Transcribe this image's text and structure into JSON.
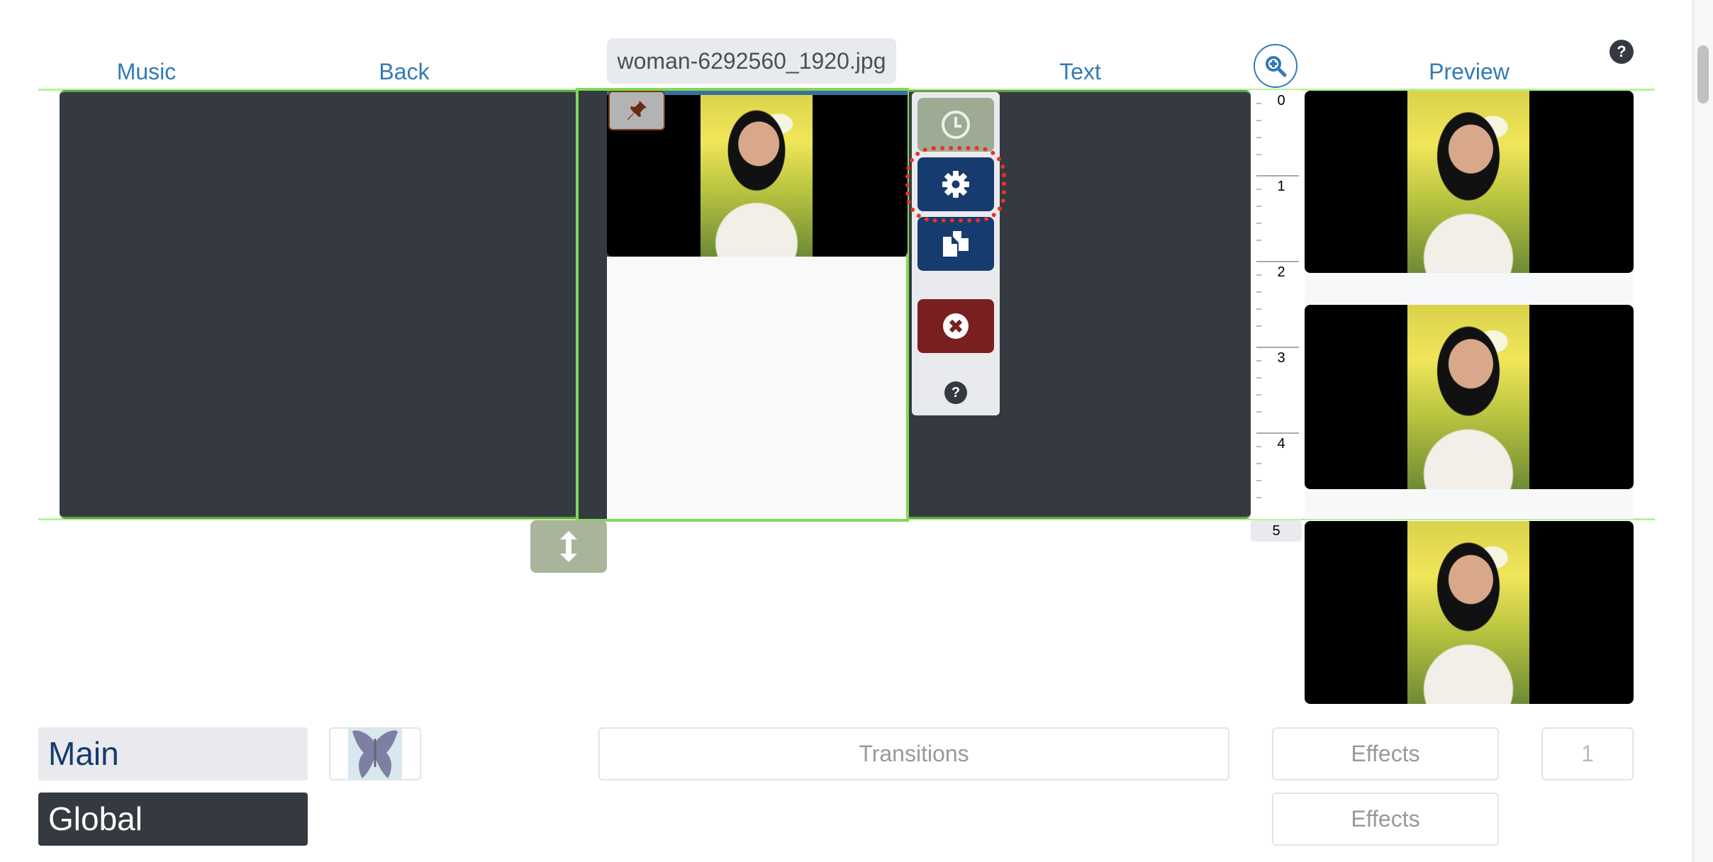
{
  "headers": {
    "music": "Music",
    "back": "Back",
    "text": "Text",
    "preview": "Preview"
  },
  "selected_clip": {
    "filename": "woman-6292560_1920.jpg",
    "pin_icon": "pushpin-icon"
  },
  "clip_toolbar": {
    "buttons": [
      {
        "name": "duration",
        "icon": "clock-icon",
        "color": "#9eab94"
      },
      {
        "name": "settings",
        "icon": "gear-icon",
        "color": "#163b6e",
        "highlighted": true
      },
      {
        "name": "duplicate",
        "icon": "copy-icon",
        "color": "#163b6e"
      },
      {
        "name": "delete",
        "icon": "times-circle-icon",
        "color": "#7a1f1f"
      }
    ],
    "help_label": "?"
  },
  "ruler": {
    "labels": [
      "0",
      "1",
      "2",
      "3",
      "4"
    ],
    "current_label": "5"
  },
  "zoom_button_icon": "zoom-in-icon",
  "help_label": "?",
  "move_handle_icon": "vertical-arrows-icon",
  "bottom": {
    "main_label": "Main",
    "global_label": "Global",
    "transitions_label": "Transitions",
    "effects_label_1": "Effects",
    "effects_label_2": "Effects",
    "count_label": "1",
    "thumbnail_icon": "butterfly-thumbnail"
  },
  "colors": {
    "accent_link": "#337ab7",
    "track_bg": "#343a40",
    "selection_border": "#7ed957",
    "highlight_dots": "#e8322a"
  }
}
